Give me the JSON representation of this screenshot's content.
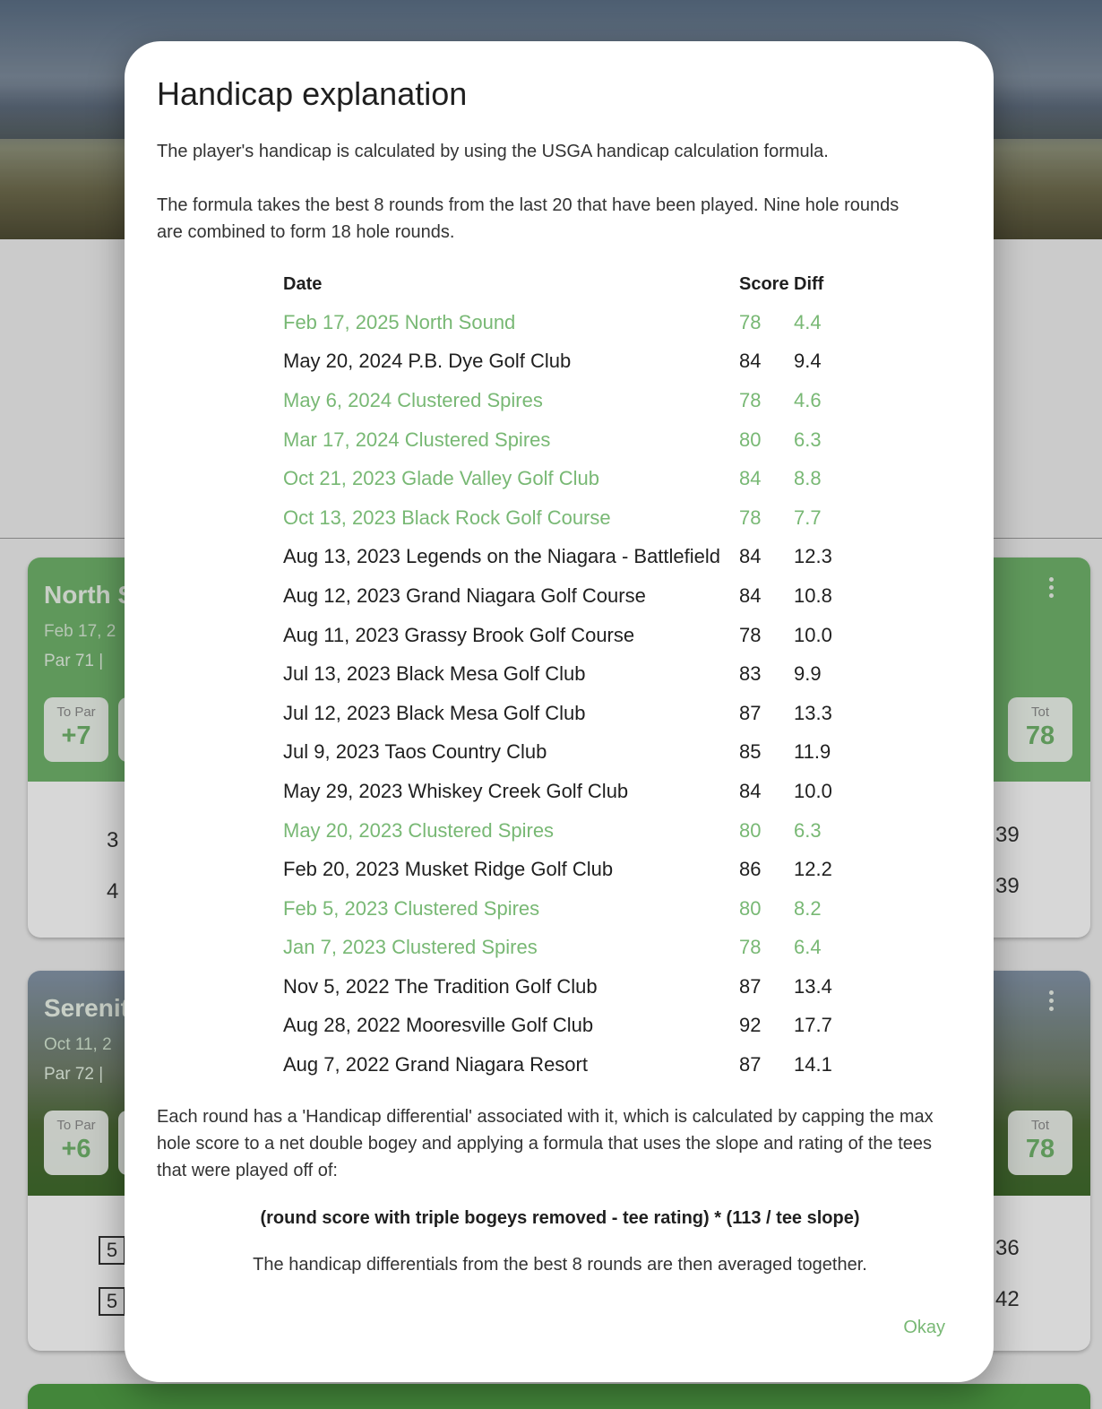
{
  "background": {
    "cards": [
      {
        "title": "North S",
        "date": "Feb 17, 2",
        "par": "Par 71  |",
        "to_par_label": "To Par",
        "to_par_value": "+7",
        "total_label": "Tot",
        "total_value": "78",
        "row_left": [
          "3",
          "4"
        ],
        "row_right": [
          "39",
          "39"
        ]
      },
      {
        "title": "Serenity",
        "date": "Oct 11, 2",
        "par": "Par 72  |",
        "to_par_label": "To Par",
        "to_par_value": "+6",
        "total_label": "Tot",
        "total_value": "78",
        "row_left": [
          "5",
          "5"
        ],
        "row_right": [
          "36",
          "42"
        ]
      }
    ]
  },
  "dialog": {
    "title": "Handicap explanation",
    "intro": "The player's handicap is calculated by using the USGA handicap calculation formula.",
    "formula_desc": "The formula takes the best 8 rounds from the last 20 that have been played. Nine hole rounds are combined to form 18 hole rounds.",
    "table": {
      "headers": {
        "date": "Date",
        "score": "Score",
        "diff": "Diff"
      },
      "rows": [
        {
          "date": "Feb 17, 2025 North Sound",
          "score": "78",
          "diff": "4.4",
          "best": true
        },
        {
          "date": "May 20, 2024 P.B. Dye Golf Club",
          "score": "84",
          "diff": "9.4",
          "best": false
        },
        {
          "date": "May 6, 2024 Clustered Spires",
          "score": "78",
          "diff": "4.6",
          "best": true
        },
        {
          "date": "Mar 17, 2024 Clustered Spires",
          "score": "80",
          "diff": "6.3",
          "best": true
        },
        {
          "date": "Oct 21, 2023 Glade Valley Golf Club",
          "score": "84",
          "diff": "8.8",
          "best": true
        },
        {
          "date": "Oct 13, 2023 Black Rock Golf Course",
          "score": "78",
          "diff": "7.7",
          "best": true
        },
        {
          "date": "Aug 13, 2023 Legends on the Niagara - Battlefield",
          "score": "84",
          "diff": "12.3",
          "best": false
        },
        {
          "date": "Aug 12, 2023 Grand Niagara Golf Course",
          "score": "84",
          "diff": "10.8",
          "best": false
        },
        {
          "date": "Aug 11, 2023 Grassy Brook Golf Course",
          "score": "78",
          "diff": "10.0",
          "best": false
        },
        {
          "date": "Jul 13, 2023 Black Mesa Golf Club",
          "score": "83",
          "diff": "9.9",
          "best": false
        },
        {
          "date": "Jul 12, 2023 Black Mesa Golf Club",
          "score": "87",
          "diff": "13.3",
          "best": false
        },
        {
          "date": "Jul 9, 2023 Taos Country Club",
          "score": "85",
          "diff": "11.9",
          "best": false
        },
        {
          "date": "May 29, 2023 Whiskey Creek Golf Club",
          "score": "84",
          "diff": "10.0",
          "best": false
        },
        {
          "date": "May 20, 2023 Clustered Spires",
          "score": "80",
          "diff": "6.3",
          "best": true
        },
        {
          "date": "Feb 20, 2023 Musket Ridge Golf Club",
          "score": "86",
          "diff": "12.2",
          "best": false
        },
        {
          "date": "Feb 5, 2023 Clustered Spires",
          "score": "80",
          "diff": "8.2",
          "best": true
        },
        {
          "date": "Jan 7, 2023 Clustered Spires",
          "score": "78",
          "diff": "6.4",
          "best": true
        },
        {
          "date": "Nov 5, 2022 The Tradition Golf Club",
          "score": "87",
          "diff": "13.4",
          "best": false
        },
        {
          "date": "Aug 28, 2022 Mooresville Golf Club",
          "score": "92",
          "diff": "17.7",
          "best": false
        },
        {
          "date": "Aug 7, 2022 Grand Niagara Resort",
          "score": "87",
          "diff": "14.1",
          "best": false
        }
      ]
    },
    "differential_desc": "Each round has a 'Handicap differential' associated with it, which is calculated by capping the max hole score to a net double bogey and applying a formula that uses the slope and rating of the tees that were played off of:",
    "formula": "(round score with triple bogeys removed - tee rating) * (113 / tee slope)",
    "averaged_note": "The handicap differentials from the best 8 rounds are then averaged together.",
    "okay_label": "Okay"
  },
  "colors": {
    "accent_green": "#78b874",
    "card_header_green": "#6fb26a",
    "text_dark": "#1f1f1f"
  }
}
